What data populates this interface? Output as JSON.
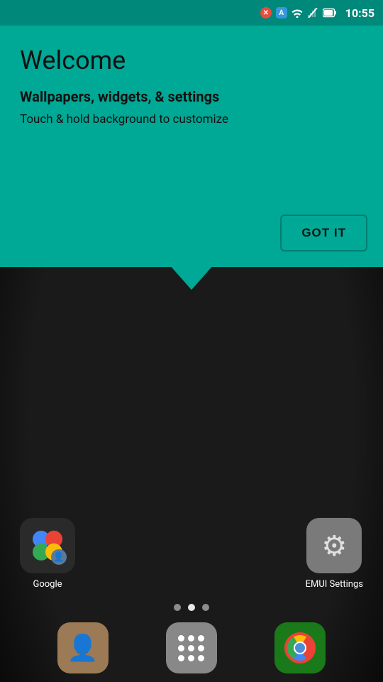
{
  "statusBar": {
    "time": "10:55",
    "icons": [
      "x-notification",
      "a-notification",
      "wifi",
      "signal-off",
      "battery"
    ]
  },
  "tooltip": {
    "title": "Welcome",
    "subtitle": "Wallpapers, widgets, & settings",
    "description": "Touch & hold background to customize",
    "button": "GOT IT"
  },
  "homescreen": {
    "apps": [
      {
        "name": "Google",
        "iconType": "google"
      },
      {
        "name": "EMUI Settings",
        "iconType": "emui"
      }
    ],
    "pageDots": [
      {
        "active": false
      },
      {
        "active": true
      },
      {
        "active": false
      }
    ]
  },
  "dock": {
    "items": [
      {
        "name": "Contacts",
        "iconType": "contacts"
      },
      {
        "name": "Apps",
        "iconType": "apps"
      },
      {
        "name": "Chrome",
        "iconType": "chrome"
      }
    ]
  }
}
